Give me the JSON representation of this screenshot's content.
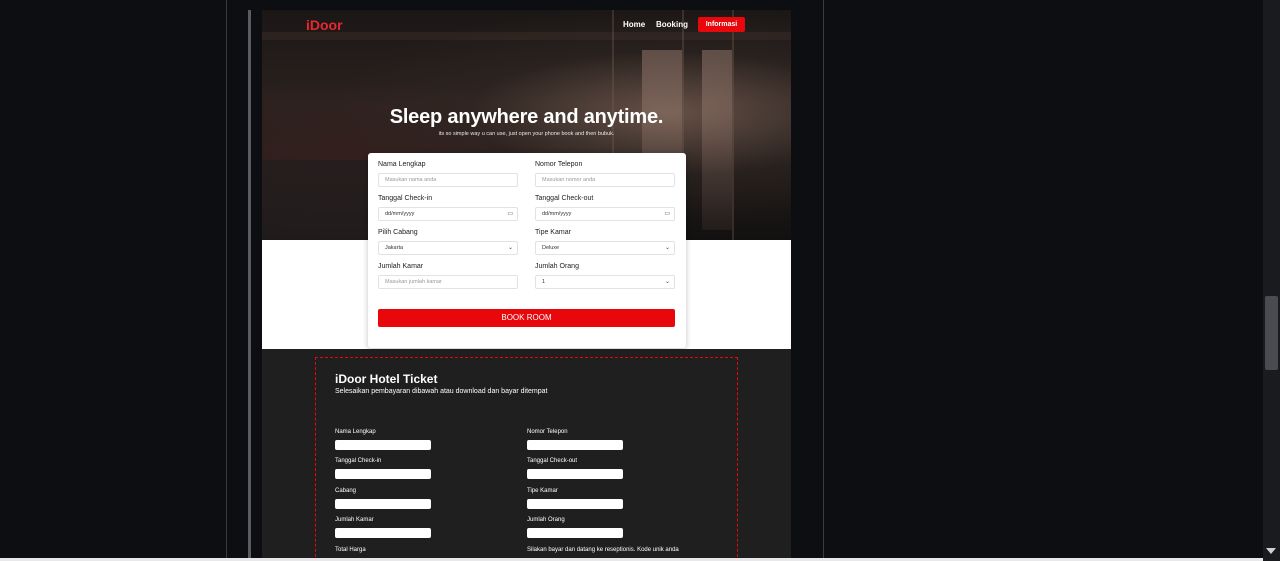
{
  "nav": {
    "logo": "iDoor",
    "home": "Home",
    "booking": "Booking",
    "informasi": "Informasi"
  },
  "hero": {
    "title": "Sleep anywhere and anytime.",
    "subtitle": "its so simple way u can use, just open your phone book and then bubuk."
  },
  "form": {
    "nama_label": "Nama Lengkap",
    "nama_placeholder": "Masukan nama anda",
    "telepon_label": "Nomor Telepon",
    "telepon_placeholder": "Masukan nomor anda",
    "checkin_label": "Tanggal Check-in",
    "checkin_value": "dd/mm/yyyy",
    "checkout_label": "Tanggal Check-out",
    "checkout_value": "dd/mm/yyyy",
    "cabang_label": "Pilih Cabang",
    "cabang_value": "Jakarta",
    "tipe_label": "Tipe Kamar",
    "tipe_value": "Deluxe",
    "jumlah_kamar_label": "Jumlah Kamar",
    "jumlah_kamar_placeholder": "Masukan jumlah kamar",
    "jumlah_orang_label": "Jumlah Orang",
    "jumlah_orang_value": "1",
    "book_button": "BOOK ROOM"
  },
  "ticket": {
    "title": "iDoor Hotel Ticket",
    "subtitle": "Selesaikan pembayaran dibawah atau download dan bayar ditempat",
    "nama": "Nama Lengkap",
    "telepon": "Nomor Telepon",
    "checkin": "Tanggal Check-in",
    "checkout": "Tanggal Check-out",
    "cabang": "Cabang",
    "tipe": "Tipe Kamar",
    "jumlah_kamar": "Jumlah Kamar",
    "jumlah_orang": "Jumlah Orang",
    "total_harga": "Total Harga",
    "note": "Silakan bayar dan datang ke reseptionis. Kode unik anda"
  }
}
